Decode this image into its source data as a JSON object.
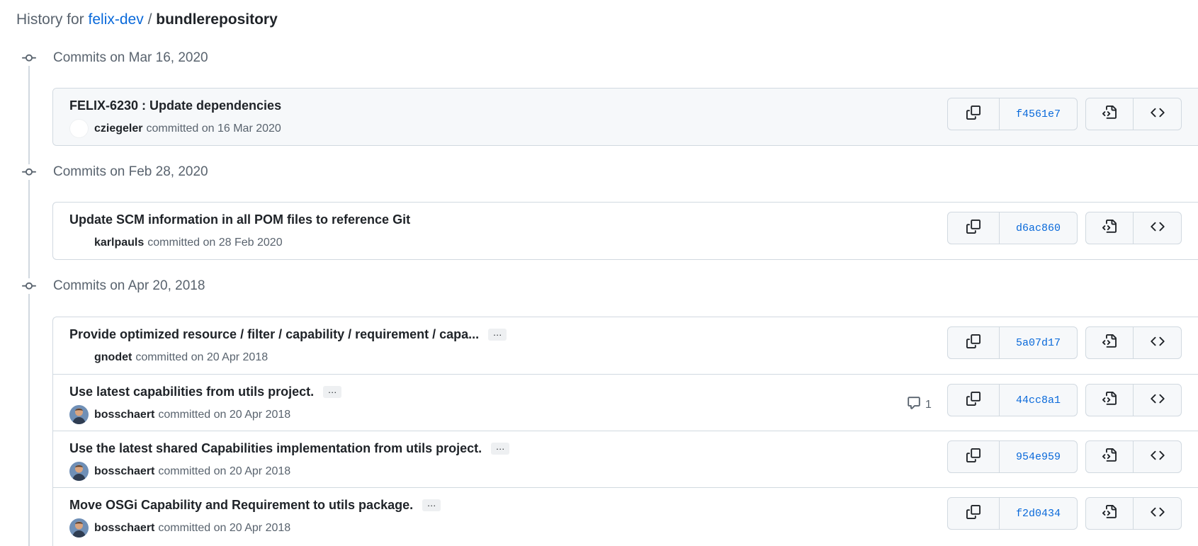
{
  "header": {
    "prefix": "History for",
    "owner": "felix-dev",
    "separator": "/",
    "repo": "bundlerepository"
  },
  "days": [
    {
      "label": "Commits on Mar 16, 2020",
      "commits": [
        {
          "message": "FELIX-6230 : Update dependencies",
          "author": "cziegeler",
          "action": "committed on 16 Mar 2020",
          "sha": "f4561e7",
          "has_ellipsis": false,
          "comments": null,
          "avatar": "empty"
        }
      ]
    },
    {
      "label": "Commits on Feb 28, 2020",
      "commits": [
        {
          "message": "Update SCM information in all POM files to reference Git",
          "author": "karlpauls",
          "action": "committed on 28 Feb 2020",
          "sha": "d6ac860",
          "has_ellipsis": false,
          "comments": null,
          "avatar": "blank"
        }
      ]
    },
    {
      "label": "Commits on Apr 20, 2018",
      "commits": [
        {
          "message": "Provide optimized resource / filter / capability / requirement / capa...",
          "author": "gnodet",
          "action": "committed on 20 Apr 2018",
          "sha": "5a07d17",
          "has_ellipsis": true,
          "comments": null,
          "avatar": "blank"
        },
        {
          "message": "Use latest capabilities from utils project.",
          "author": "bosschaert",
          "action": "committed on 20 Apr 2018",
          "sha": "44cc8a1",
          "has_ellipsis": true,
          "comments": "1",
          "avatar": "photo"
        },
        {
          "message": "Use the latest shared Capabilities implementation from utils project.",
          "author": "bosschaert",
          "action": "committed on 20 Apr 2018",
          "sha": "954e959",
          "has_ellipsis": true,
          "comments": null,
          "avatar": "photo"
        },
        {
          "message": "Move OSGi Capability and Requirement to utils package.",
          "author": "bosschaert",
          "action": "committed on 20 Apr 2018",
          "sha": "f2d0434",
          "has_ellipsis": true,
          "comments": null,
          "avatar": "photo"
        }
      ]
    }
  ],
  "ellipsis_text": "…",
  "icons": {
    "day": "git-commit-icon",
    "copy": "copy-icon",
    "browse_files": "file-code-icon",
    "browse_code": "code-icon",
    "comment": "comment-icon"
  },
  "colors": {
    "link": "#0969da",
    "muted": "#59636e",
    "border": "#d1d9e0",
    "highlight_row": "#f6f8fa"
  }
}
